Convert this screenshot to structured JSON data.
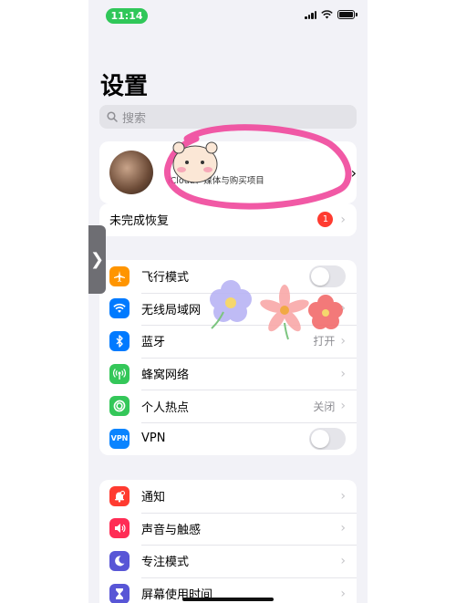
{
  "status_bar": {
    "time": "11:14"
  },
  "page": {
    "title": "设置"
  },
  "search": {
    "placeholder": "搜索"
  },
  "profile": {
    "subtitle": "iCloud、媒体与购买项目"
  },
  "recovery": {
    "label": "未完成恢复",
    "badge": "1"
  },
  "connectivity": [
    {
      "label": "飞行模式",
      "icon": "airplane-icon",
      "color": "#ff9500",
      "control": "toggle"
    },
    {
      "label": "无线局域网",
      "icon": "wifi-icon",
      "color": "#007aff",
      "control": "chevron",
      "value": ""
    },
    {
      "label": "蓝牙",
      "icon": "bluetooth-icon",
      "color": "#007aff",
      "control": "chevron",
      "value": "打开"
    },
    {
      "label": "蜂窝网络",
      "icon": "cellular-icon",
      "color": "#34c759",
      "control": "chevron"
    },
    {
      "label": "个人热点",
      "icon": "hotspot-icon",
      "color": "#34c759",
      "control": "chevron",
      "value": "关闭"
    },
    {
      "label": "VPN",
      "icon": "vpn-icon",
      "icon_text": "VPN",
      "color": "#0a84ff",
      "control": "toggle"
    }
  ],
  "general": [
    {
      "label": "通知",
      "icon": "bell-icon",
      "color": "#ff3b30"
    },
    {
      "label": "声音与触感",
      "icon": "speaker-icon",
      "color": "#ff2d55"
    },
    {
      "label": "专注模式",
      "icon": "moon-icon",
      "color": "#5856d6"
    },
    {
      "label": "屏幕使用时间",
      "icon": "hourglass-icon",
      "color": "#5856d6"
    }
  ],
  "colors": {
    "annotation": "#f0479b"
  }
}
